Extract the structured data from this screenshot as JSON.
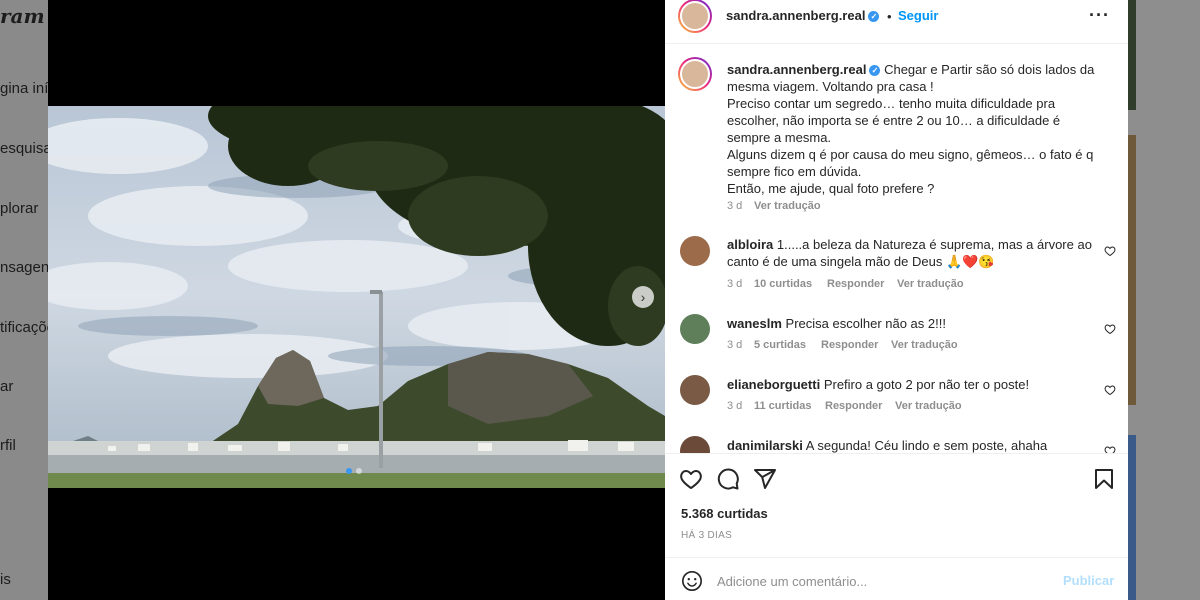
{
  "nav": {
    "logo": "ram",
    "items": [
      {
        "label": "gina iníc"
      },
      {
        "label": "esquisa"
      },
      {
        "label": "plorar"
      },
      {
        "label": "nsagens"
      },
      {
        "label": "tificações"
      },
      {
        "label": "ar"
      },
      {
        "label": "rfil"
      },
      {
        "label": "is"
      }
    ]
  },
  "header": {
    "username": "sandra.annenberg.real",
    "separator": "•",
    "follow_label": "Seguir",
    "more_label": "···"
  },
  "caption": {
    "username": "sandra.annenberg.real",
    "text": "Chegar e Partir são só dois lados da mesma viagem. Voltando pra casa !\nPreciso contar um segredo… tenho muita dificuldade pra escolher, não importa se é entre 2 ou 10… a dificuldade é sempre a mesma.\nAlguns dizem q é por causa do meu signo, gêmeos… o fato é q sempre fico em dúvida.\nEntão, me ajude, qual foto prefere ?",
    "time": "3 d",
    "translate": "Ver tradução"
  },
  "comments": [
    {
      "username": "albloira",
      "text": "1.....a beleza da Natureza é suprema, mas a árvore ao canto é de uma singela mão de Deus 🙏❤️😘",
      "time": "3 d",
      "likes": "10 curtidas",
      "reply": "Responder",
      "translate": "Ver tradução"
    },
    {
      "username": "waneslm",
      "text": "Precisa escolher não as 2!!!",
      "time": "3 d",
      "likes": "5 curtidas",
      "reply": "Responder",
      "translate": "Ver tradução"
    },
    {
      "username": "elianeborguetti",
      "text": "Prefiro a goto 2 por não ter o poste!",
      "time": "3 d",
      "likes": "11 curtidas",
      "reply": "Responder",
      "translate": "Ver tradução"
    },
    {
      "username": "danimilarski",
      "text": "A segunda! Céu lindo e sem poste, ahaha"
    }
  ],
  "actions": {
    "likes": "5.368 curtidas",
    "posted": "HÁ 3 DIAS"
  },
  "add_comment": {
    "placeholder": "Adicione um comentário...",
    "publish_label": "Publicar"
  },
  "carousel": {
    "current": 1,
    "total": 2
  },
  "colors": {
    "accent": "#0095f6",
    "verified": "#3897f0",
    "muted": "#8e8e8e",
    "heart": "#ed4956"
  }
}
